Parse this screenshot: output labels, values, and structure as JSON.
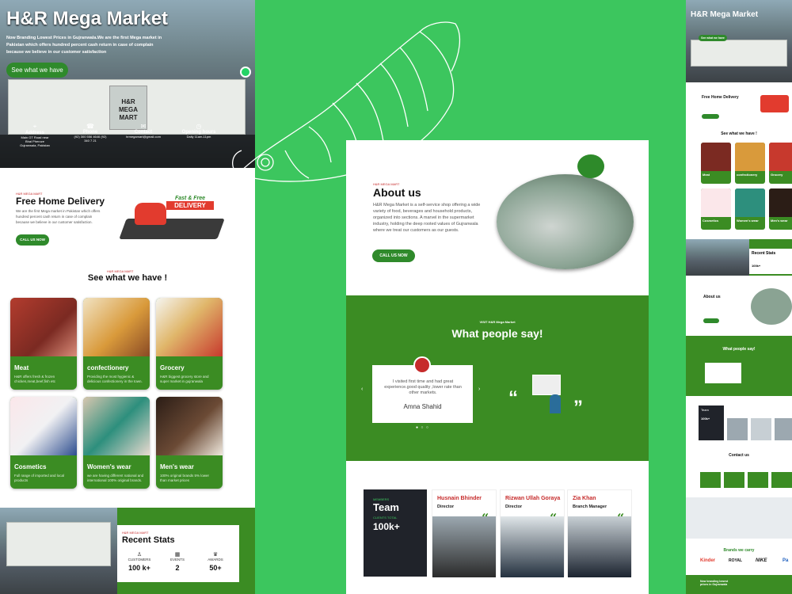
{
  "hero": {
    "title": "H&R Mega Market",
    "subtitle": "Now Branding Lowest Prices in Gujranwala.We are the first Mega market in Pakistan which offers hundred percent cash return in case of complain because we believe in our customer satisfaction",
    "cta": "See what we have",
    "sign": "H&R MEGA MART"
  },
  "info": [
    {
      "label": "Address",
      "value": "Main GT Road near Bhai Pheroze Gujranwala, Pakistan"
    },
    {
      "label": "Phone",
      "value": "(92) 300 556 4646 (92) 340 7 21"
    },
    {
      "label": "Contact",
      "value": "hrmegamart@gmail.com"
    },
    {
      "label": "Opening hours",
      "value": "Daily 11am-11pm"
    }
  ],
  "delivery": {
    "kicker": "H&R MEGA MART",
    "title": "Free Home Delivery",
    "text": "We are the first Mega market in Pakistan which offers hundred percent cash return in case of complain because we believe in our customer satisfaction.",
    "cta": "CALL US NOW",
    "badge1": "Fast & Free",
    "badge2": "DELIVERY"
  },
  "products": {
    "kicker": "H&R MEGA MART",
    "title": "See what we have !",
    "items": [
      {
        "name": "Meat",
        "desc": "H&R offers fresh & frozen chicken,meat,beef,fish etc"
      },
      {
        "name": "confectionery",
        "desc": "Providing the most hygienic & delicious confectionery in the town."
      },
      {
        "name": "Grocery",
        "desc": "H&R biggest grocery store and super market in gujranwala"
      },
      {
        "name": "Cosmetics",
        "desc": "Full range of imported and local products"
      },
      {
        "name": "Women's wear",
        "desc": "we are having different national and international 100% original brands."
      },
      {
        "name": "Men's wear",
        "desc": "100% original brands 5% lower than market prices"
      }
    ]
  },
  "stats": {
    "kicker": "H&R MEGA MART",
    "title": "Recent Stats",
    "items": [
      {
        "label": "CUSTOMERS",
        "value": "100 k+"
      },
      {
        "label": "EVENTS",
        "value": "2"
      },
      {
        "label": "AWARDS",
        "value": "50+"
      }
    ]
  },
  "about": {
    "kicker": "H&R MEGA MART",
    "title": "About us",
    "text": "H&R Mega Market is a self-service shop offering a wide variety of food, beverages and household products, organized into sections. A marvel in the supermarket industry, holding the deep rooted values of Gujranwala where we treat our customers as our guests.",
    "cta": "CALL US NOW"
  },
  "testimonials": {
    "kicker": "VISIT H&R Mega Market",
    "title": "What people say!",
    "quote": "I visited first time and had great experience.good quality ,lower rate than other markets.",
    "author": "Amna Shahid"
  },
  "team": {
    "label1": "MEMBERS",
    "title": "Team",
    "label2": "CLIENTS TOTAL",
    "count": "100k+",
    "members": [
      {
        "name": "Husnain Bhinder",
        "role": "Director"
      },
      {
        "name": "Rizwan Ullah Goraya",
        "role": "Director"
      },
      {
        "name": "Zia Khan",
        "role": "Branch Manager"
      }
    ]
  },
  "mobile": {
    "title": "H&R Mega Market",
    "cta": "See what we have",
    "delivery": "Free Home Delivery",
    "see": "See what we have !",
    "stats": "Recent Stats",
    "about": "About us",
    "say": "What people say!",
    "contact": "Contact us",
    "brands": "Brands we carry",
    "footer": "Now branding lowest prices in Gujranwala",
    "statnum": "100k+",
    "teamnum": "100k+",
    "team": "Team",
    "cards": [
      "Meat",
      "confectionery",
      "Grocery",
      "Cosmetics",
      "Women's wear",
      "Men's wear"
    ],
    "brandlist": [
      "Kinder",
      "ROYAL",
      "NIKE",
      "Pa"
    ]
  }
}
